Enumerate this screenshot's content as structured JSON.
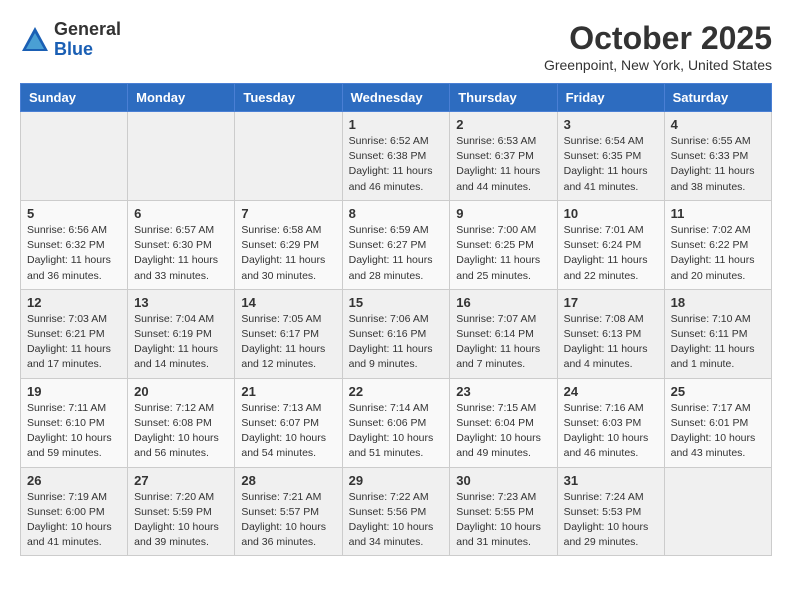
{
  "header": {
    "logo_general": "General",
    "logo_blue": "Blue",
    "month_title": "October 2025",
    "location": "Greenpoint, New York, United States"
  },
  "weekdays": [
    "Sunday",
    "Monday",
    "Tuesday",
    "Wednesday",
    "Thursday",
    "Friday",
    "Saturday"
  ],
  "weeks": [
    [
      {
        "day": "",
        "info": ""
      },
      {
        "day": "",
        "info": ""
      },
      {
        "day": "",
        "info": ""
      },
      {
        "day": "1",
        "info": "Sunrise: 6:52 AM\nSunset: 6:38 PM\nDaylight: 11 hours\nand 46 minutes."
      },
      {
        "day": "2",
        "info": "Sunrise: 6:53 AM\nSunset: 6:37 PM\nDaylight: 11 hours\nand 44 minutes."
      },
      {
        "day": "3",
        "info": "Sunrise: 6:54 AM\nSunset: 6:35 PM\nDaylight: 11 hours\nand 41 minutes."
      },
      {
        "day": "4",
        "info": "Sunrise: 6:55 AM\nSunset: 6:33 PM\nDaylight: 11 hours\nand 38 minutes."
      }
    ],
    [
      {
        "day": "5",
        "info": "Sunrise: 6:56 AM\nSunset: 6:32 PM\nDaylight: 11 hours\nand 36 minutes."
      },
      {
        "day": "6",
        "info": "Sunrise: 6:57 AM\nSunset: 6:30 PM\nDaylight: 11 hours\nand 33 minutes."
      },
      {
        "day": "7",
        "info": "Sunrise: 6:58 AM\nSunset: 6:29 PM\nDaylight: 11 hours\nand 30 minutes."
      },
      {
        "day": "8",
        "info": "Sunrise: 6:59 AM\nSunset: 6:27 PM\nDaylight: 11 hours\nand 28 minutes."
      },
      {
        "day": "9",
        "info": "Sunrise: 7:00 AM\nSunset: 6:25 PM\nDaylight: 11 hours\nand 25 minutes."
      },
      {
        "day": "10",
        "info": "Sunrise: 7:01 AM\nSunset: 6:24 PM\nDaylight: 11 hours\nand 22 minutes."
      },
      {
        "day": "11",
        "info": "Sunrise: 7:02 AM\nSunset: 6:22 PM\nDaylight: 11 hours\nand 20 minutes."
      }
    ],
    [
      {
        "day": "12",
        "info": "Sunrise: 7:03 AM\nSunset: 6:21 PM\nDaylight: 11 hours\nand 17 minutes."
      },
      {
        "day": "13",
        "info": "Sunrise: 7:04 AM\nSunset: 6:19 PM\nDaylight: 11 hours\nand 14 minutes."
      },
      {
        "day": "14",
        "info": "Sunrise: 7:05 AM\nSunset: 6:17 PM\nDaylight: 11 hours\nand 12 minutes."
      },
      {
        "day": "15",
        "info": "Sunrise: 7:06 AM\nSunset: 6:16 PM\nDaylight: 11 hours\nand 9 minutes."
      },
      {
        "day": "16",
        "info": "Sunrise: 7:07 AM\nSunset: 6:14 PM\nDaylight: 11 hours\nand 7 minutes."
      },
      {
        "day": "17",
        "info": "Sunrise: 7:08 AM\nSunset: 6:13 PM\nDaylight: 11 hours\nand 4 minutes."
      },
      {
        "day": "18",
        "info": "Sunrise: 7:10 AM\nSunset: 6:11 PM\nDaylight: 11 hours\nand 1 minute."
      }
    ],
    [
      {
        "day": "19",
        "info": "Sunrise: 7:11 AM\nSunset: 6:10 PM\nDaylight: 10 hours\nand 59 minutes."
      },
      {
        "day": "20",
        "info": "Sunrise: 7:12 AM\nSunset: 6:08 PM\nDaylight: 10 hours\nand 56 minutes."
      },
      {
        "day": "21",
        "info": "Sunrise: 7:13 AM\nSunset: 6:07 PM\nDaylight: 10 hours\nand 54 minutes."
      },
      {
        "day": "22",
        "info": "Sunrise: 7:14 AM\nSunset: 6:06 PM\nDaylight: 10 hours\nand 51 minutes."
      },
      {
        "day": "23",
        "info": "Sunrise: 7:15 AM\nSunset: 6:04 PM\nDaylight: 10 hours\nand 49 minutes."
      },
      {
        "day": "24",
        "info": "Sunrise: 7:16 AM\nSunset: 6:03 PM\nDaylight: 10 hours\nand 46 minutes."
      },
      {
        "day": "25",
        "info": "Sunrise: 7:17 AM\nSunset: 6:01 PM\nDaylight: 10 hours\nand 43 minutes."
      }
    ],
    [
      {
        "day": "26",
        "info": "Sunrise: 7:19 AM\nSunset: 6:00 PM\nDaylight: 10 hours\nand 41 minutes."
      },
      {
        "day": "27",
        "info": "Sunrise: 7:20 AM\nSunset: 5:59 PM\nDaylight: 10 hours\nand 39 minutes."
      },
      {
        "day": "28",
        "info": "Sunrise: 7:21 AM\nSunset: 5:57 PM\nDaylight: 10 hours\nand 36 minutes."
      },
      {
        "day": "29",
        "info": "Sunrise: 7:22 AM\nSunset: 5:56 PM\nDaylight: 10 hours\nand 34 minutes."
      },
      {
        "day": "30",
        "info": "Sunrise: 7:23 AM\nSunset: 5:55 PM\nDaylight: 10 hours\nand 31 minutes."
      },
      {
        "day": "31",
        "info": "Sunrise: 7:24 AM\nSunset: 5:53 PM\nDaylight: 10 hours\nand 29 minutes."
      },
      {
        "day": "",
        "info": ""
      }
    ]
  ]
}
